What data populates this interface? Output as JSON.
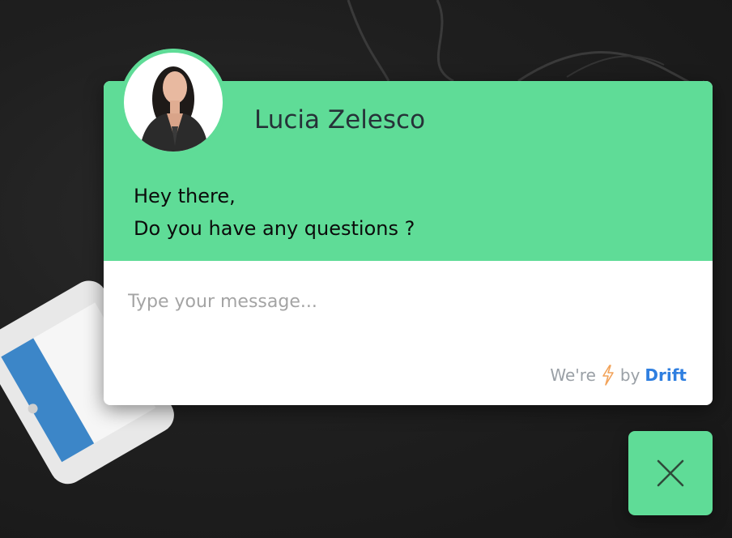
{
  "widget": {
    "agent_name": "Lucia Zelesco",
    "greeting_lines": [
      "Hey there,",
      "Do you have any questions ?"
    ],
    "input_placeholder": "Type your message...",
    "input_value": "",
    "powered_prefix": "We're",
    "powered_icon": "lightning-bolt-icon",
    "powered_by": "by",
    "brand": "Drift",
    "close_icon": "close-icon"
  },
  "colors": {
    "accent": "#5fdc97",
    "brand_link": "#2f7fe0",
    "background": "#1c1c1c"
  }
}
